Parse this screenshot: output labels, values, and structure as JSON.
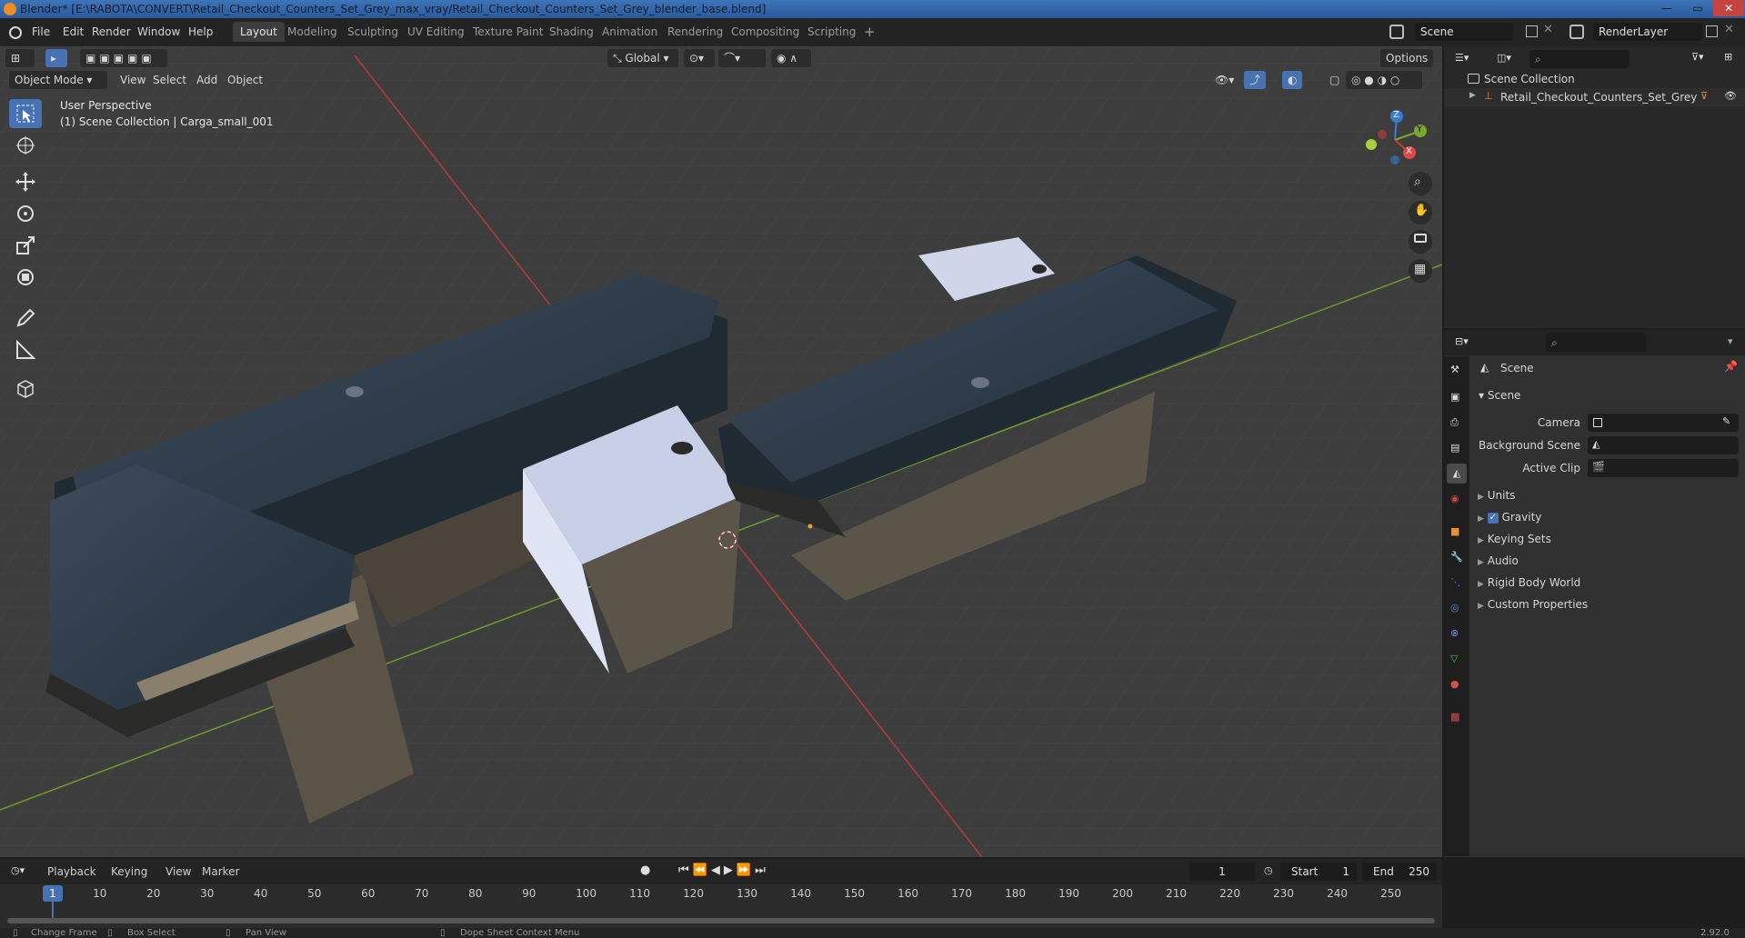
{
  "titlebar": {
    "title": "Blender* [E:\\RABOTA\\CONVERT\\Retail_Checkout_Counters_Set_Grey_max_vray/Retail_Checkout_Counters_Set_Grey_blender_base.blend]",
    "minimize": "—",
    "maximize": "▭",
    "close": "✕"
  },
  "menu": {
    "file": "File",
    "edit": "Edit",
    "render": "Render",
    "window": "Window",
    "help": "Help"
  },
  "workspaces": [
    "Layout",
    "Modeling",
    "Sculpting",
    "UV Editing",
    "Texture Paint",
    "Shading",
    "Animation",
    "Rendering",
    "Compositing",
    "Scripting"
  ],
  "workspace_add": "+",
  "scene_field": "Scene",
  "renderlayer_field": "RenderLayer",
  "viewport": {
    "mode": "Object Mode",
    "menus": [
      "View",
      "Select",
      "Add",
      "Object"
    ],
    "transform_orientation": "Global",
    "options": "Options",
    "overlay_line1": "User Perspective",
    "overlay_line2": "(1) Scene Collection | Carga_small_001",
    "gizmo": {
      "x": "X",
      "y": "Y",
      "z": "Z"
    }
  },
  "outliner": {
    "root": "Scene Collection",
    "item": "Retail_Checkout_Counters_Set_Grey"
  },
  "properties": {
    "header": "Scene",
    "section": "Scene",
    "camera_label": "Camera",
    "background_scene_label": "Background Scene",
    "active_clip_label": "Active Clip",
    "panels": [
      "Units",
      "Gravity",
      "Keying Sets",
      "Audio",
      "Rigid Body World",
      "Custom Properties"
    ],
    "gravity_checked": true
  },
  "timeline": {
    "menus": [
      "Playback",
      "Keying",
      "View",
      "Marker"
    ],
    "current_frame": "1",
    "start_label": "Start",
    "start_value": "1",
    "end_label": "End",
    "end_value": "250",
    "ticks": [
      "10",
      "20",
      "30",
      "40",
      "50",
      "60",
      "70",
      "80",
      "90",
      "100",
      "110",
      "120",
      "130",
      "140",
      "150",
      "160",
      "170",
      "180",
      "190",
      "200",
      "210",
      "220",
      "230",
      "240",
      "250"
    ],
    "playhead": "1"
  },
  "status": {
    "change_frame": "Change Frame",
    "box_select": "Box Select",
    "pan_view": "Pan View",
    "context_menu": "Dope Sheet Context Menu",
    "version": "2.92.0"
  },
  "colors": {
    "accent": "#4772b3",
    "viewport_bg": "#3d3d3d",
    "x_axis": "#c93b3b",
    "y_axis": "#7aa82b",
    "z_axis": "#3a7bd5"
  }
}
